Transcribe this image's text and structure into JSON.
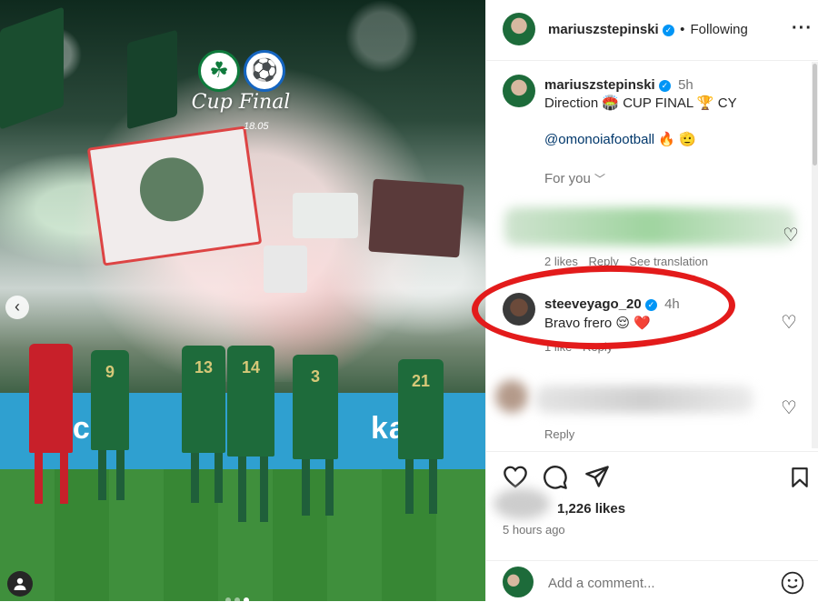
{
  "post": {
    "author": "mariuszstepinski",
    "follow_status": "Following",
    "more_icon": "more-horizontal-icon",
    "media": {
      "overlay_title": "Cup Final",
      "overlay_date": "18.05",
      "club_logos": [
        "omonoia-crest",
        "pafos-crest"
      ],
      "carousel_total": 3,
      "carousel_current": 3
    }
  },
  "caption": {
    "author": "mariuszstepinski",
    "time": "5h",
    "text": "Direction 🏟️ CUP FINAL 🏆 CY",
    "mention": "@omonoiafootball 🔥 🫡"
  },
  "for_you_label": "For you",
  "comments": [
    {
      "author": "",
      "text": "",
      "likes": "2 likes",
      "reply": "Reply",
      "translate": "See translation",
      "hidden": true
    },
    {
      "author": "steeveyago_20",
      "time": "4h",
      "text": "Bravo frero 😌 ❤️",
      "likes": "1 like",
      "reply": "Reply",
      "hidden": false
    },
    {
      "author": "",
      "text": "",
      "reply": "Reply",
      "hidden": true
    }
  ],
  "actions": {
    "likes_count": "1,226 likes",
    "posted_ago": "5 hours ago"
  },
  "comment_input": {
    "placeholder": "Add a comment..."
  },
  "colors": {
    "verified": "#0095f6",
    "annotation_circle": "#e31b1b",
    "link": "#00376b"
  }
}
